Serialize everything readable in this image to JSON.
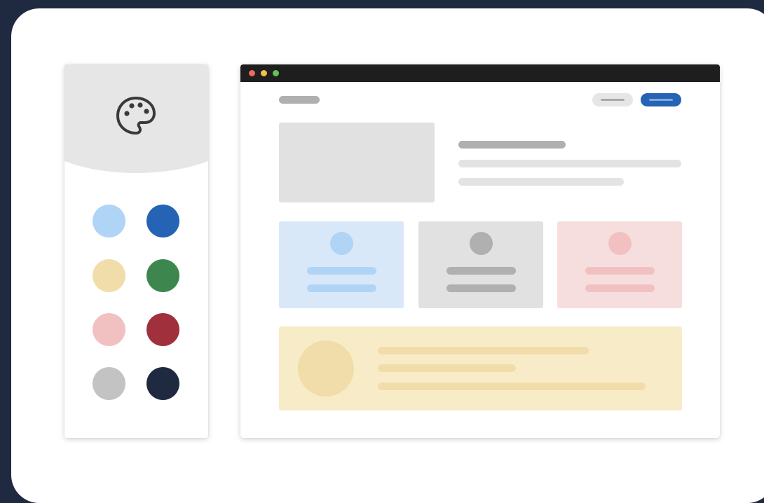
{
  "palette": {
    "icon": "palette-icon",
    "swatches": [
      {
        "name": "light-blue",
        "color": "#afd4f6"
      },
      {
        "name": "blue",
        "color": "#2563b4"
      },
      {
        "name": "light-yellow",
        "color": "#f1dda9"
      },
      {
        "name": "green",
        "color": "#3d874f"
      },
      {
        "name": "light-pink",
        "color": "#f1c1c1"
      },
      {
        "name": "red",
        "color": "#a0303b"
      },
      {
        "name": "light-gray",
        "color": "#c3c3c3"
      },
      {
        "name": "navy",
        "color": "#1f2a40"
      }
    ]
  },
  "browser": {
    "window_controls": [
      "close-dot",
      "minimize-dot",
      "maximize-dot"
    ],
    "colors": {
      "close": "#ed6a5e",
      "minimize": "#f4bf4f",
      "maximize": "#61c554",
      "primary_button": "#2563b4",
      "secondary_button": "#e6e6e6",
      "card_blue": "#d9e8f9",
      "card_gray": "#e1e1e1",
      "card_pink": "#f7dede",
      "banner_yellow": "#f8ecc8"
    }
  }
}
